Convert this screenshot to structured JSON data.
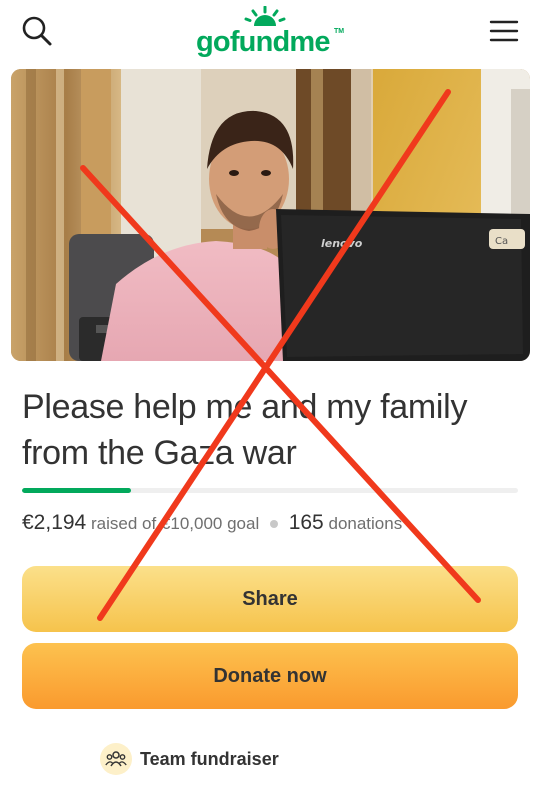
{
  "header": {
    "logo_text": "gofundme",
    "logo_tm": "TM",
    "search_icon": "search-icon",
    "menu_icon": "hamburger-menu-icon"
  },
  "fundraiser": {
    "title": "Please help me and my family from the Gaza war",
    "raised_amount": "€2,194",
    "raised_of_text": "raised of",
    "goal_amount": "€10,000 goal",
    "donation_count": "165",
    "donations_label": "donations",
    "progress_fraction": 0.2194
  },
  "hero": {
    "laptop_brand": "lenovo",
    "sticker_text": "Ca"
  },
  "actions": {
    "share_label": "Share",
    "donate_label": "Donate now"
  },
  "team": {
    "label": "Team fundraiser",
    "icon": "people-group-icon"
  },
  "colors": {
    "brand_green": "#02a95c",
    "share_yellow": "#f6c34c",
    "donate_orange": "#fa9a2e",
    "cross_red": "#f0391c"
  }
}
